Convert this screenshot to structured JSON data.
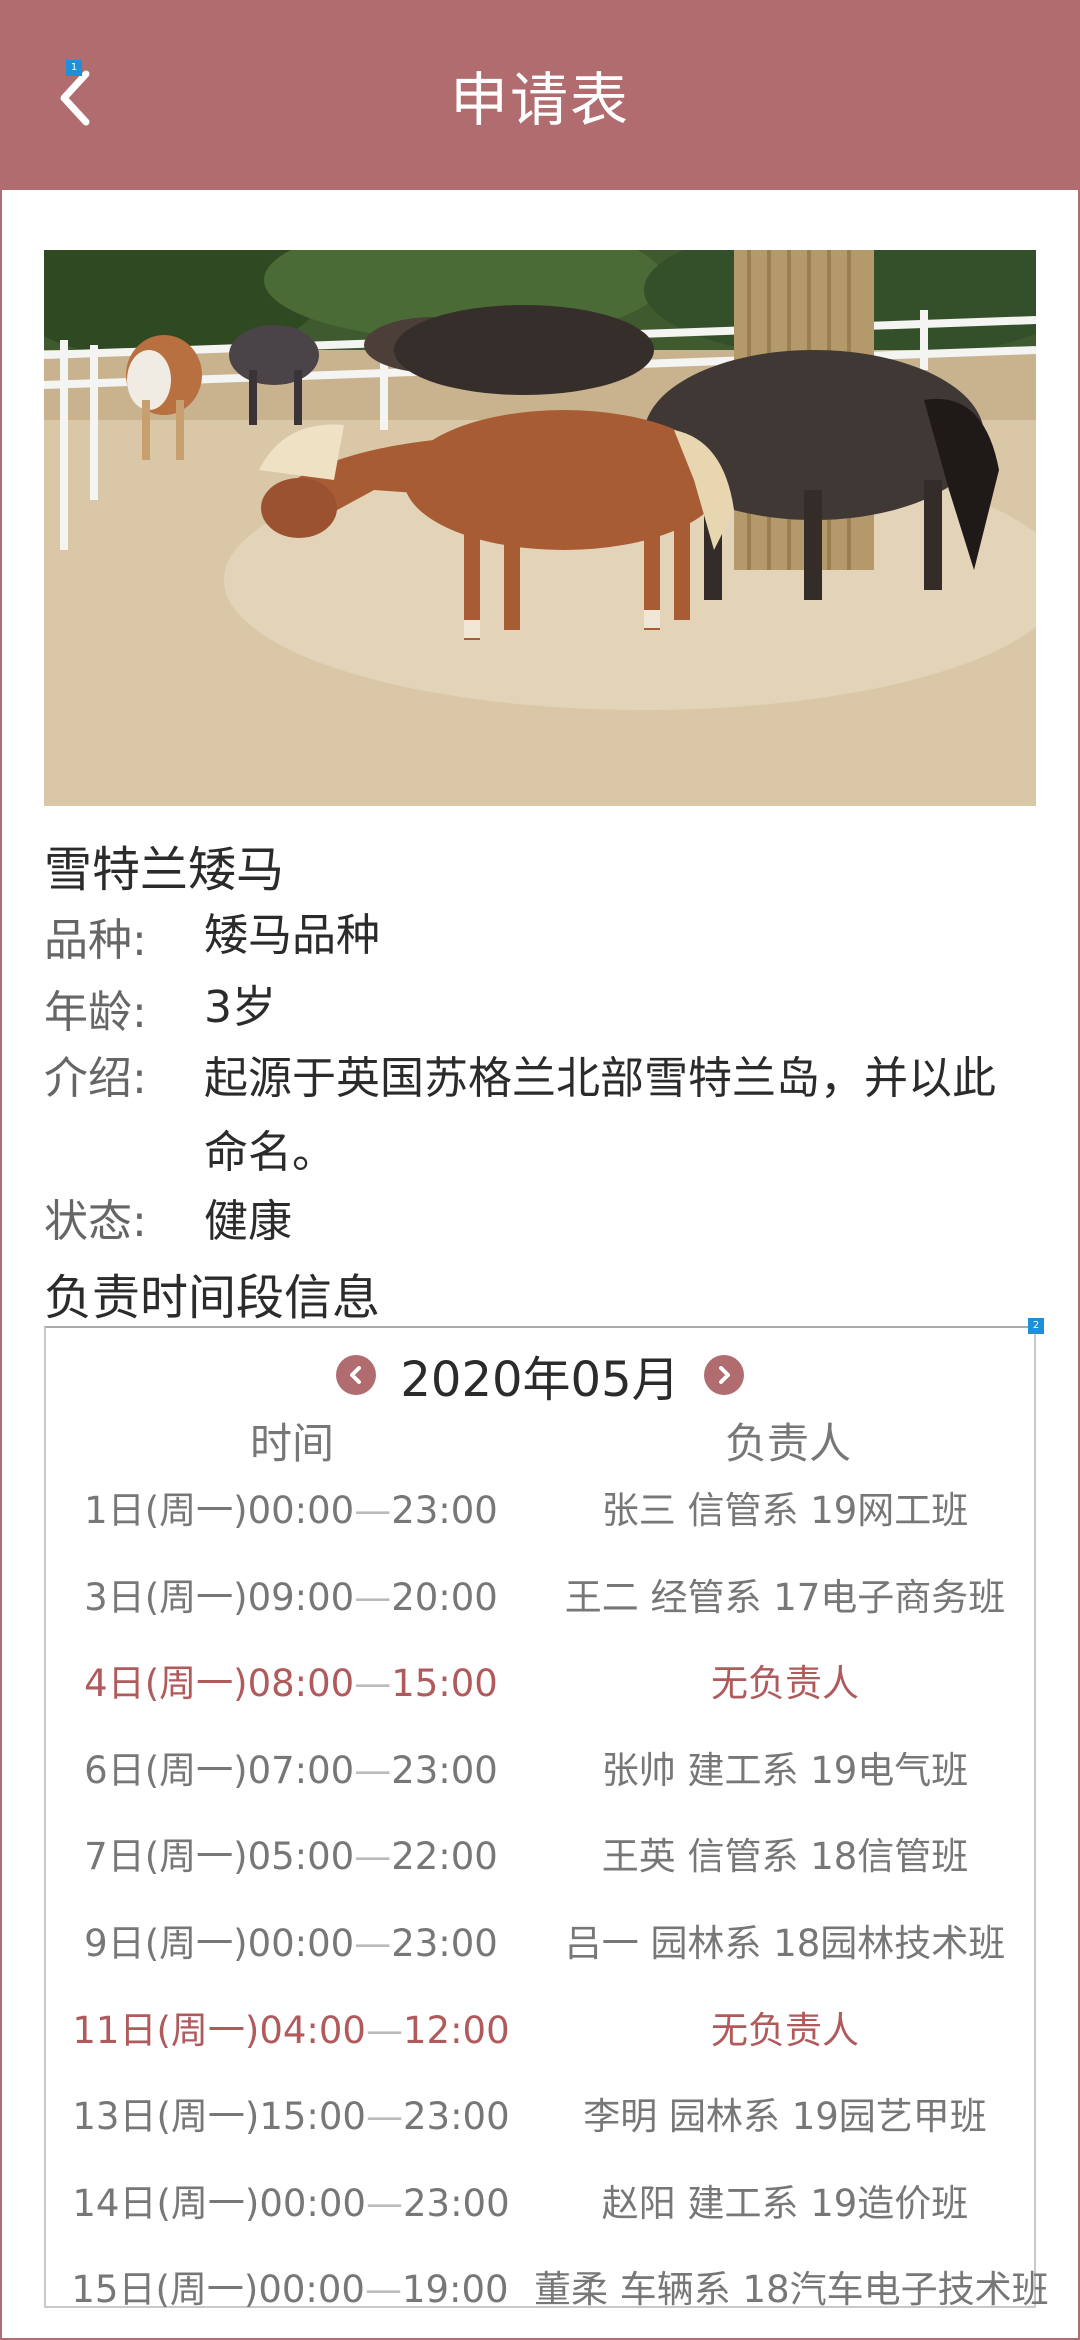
{
  "header": {
    "title": "申请表"
  },
  "markers": {
    "back": "1",
    "calendar": "2"
  },
  "animal": {
    "name": "雪特兰矮马",
    "fields": [
      {
        "label": "品种:",
        "value": "矮马品种"
      },
      {
        "label": "年龄:",
        "value": "3岁"
      },
      {
        "label": "介绍:",
        "value": "起源于英国苏格兰北部雪特兰岛，并以此命名。"
      },
      {
        "label": "状态:",
        "value": "健康"
      }
    ]
  },
  "schedule": {
    "title": "负责时间段信息",
    "month": "2020年05月",
    "col_time": "时间",
    "col_person": "负责人",
    "rows": [
      {
        "day": "1日(周一)",
        "start": "00:00",
        "end": "23:00",
        "person": "张三  信管系  19网工班"
      },
      {
        "day": "3日(周一)",
        "start": "09:00",
        "end": "20:00",
        "person": "王二  经管系  17电子商务班"
      },
      {
        "day": "4日(周一)",
        "start": "08:00",
        "end": "15:00",
        "person": "无负责人"
      },
      {
        "day": "6日(周一)",
        "start": "07:00",
        "end": "23:00",
        "person": "张帅  建工系  19电气班"
      },
      {
        "day": "7日(周一)",
        "start": "05:00",
        "end": "22:00",
        "person": "王英  信管系  18信管班"
      },
      {
        "day": "9日(周一)",
        "start": "00:00",
        "end": "23:00",
        "person": "吕一  园林系  18园林技术班"
      },
      {
        "day": "11日(周一)",
        "start": "04:00",
        "end": "12:00",
        "person": "无负责人"
      },
      {
        "day": "13日(周一)",
        "start": "15:00",
        "end": "23:00",
        "person": "李明  园林系  19园艺甲班"
      },
      {
        "day": "14日(周一)",
        "start": "00:00",
        "end": "23:00",
        "person": "赵阳  建工系  19造价班"
      },
      {
        "day": "15日(周一)",
        "start": "00:00",
        "end": "19:00",
        "person": "董柔  车辆系  18汽车电子技术班"
      }
    ]
  },
  "colors": {
    "brand": "#b06c6e",
    "alert": "#b05a5c"
  }
}
